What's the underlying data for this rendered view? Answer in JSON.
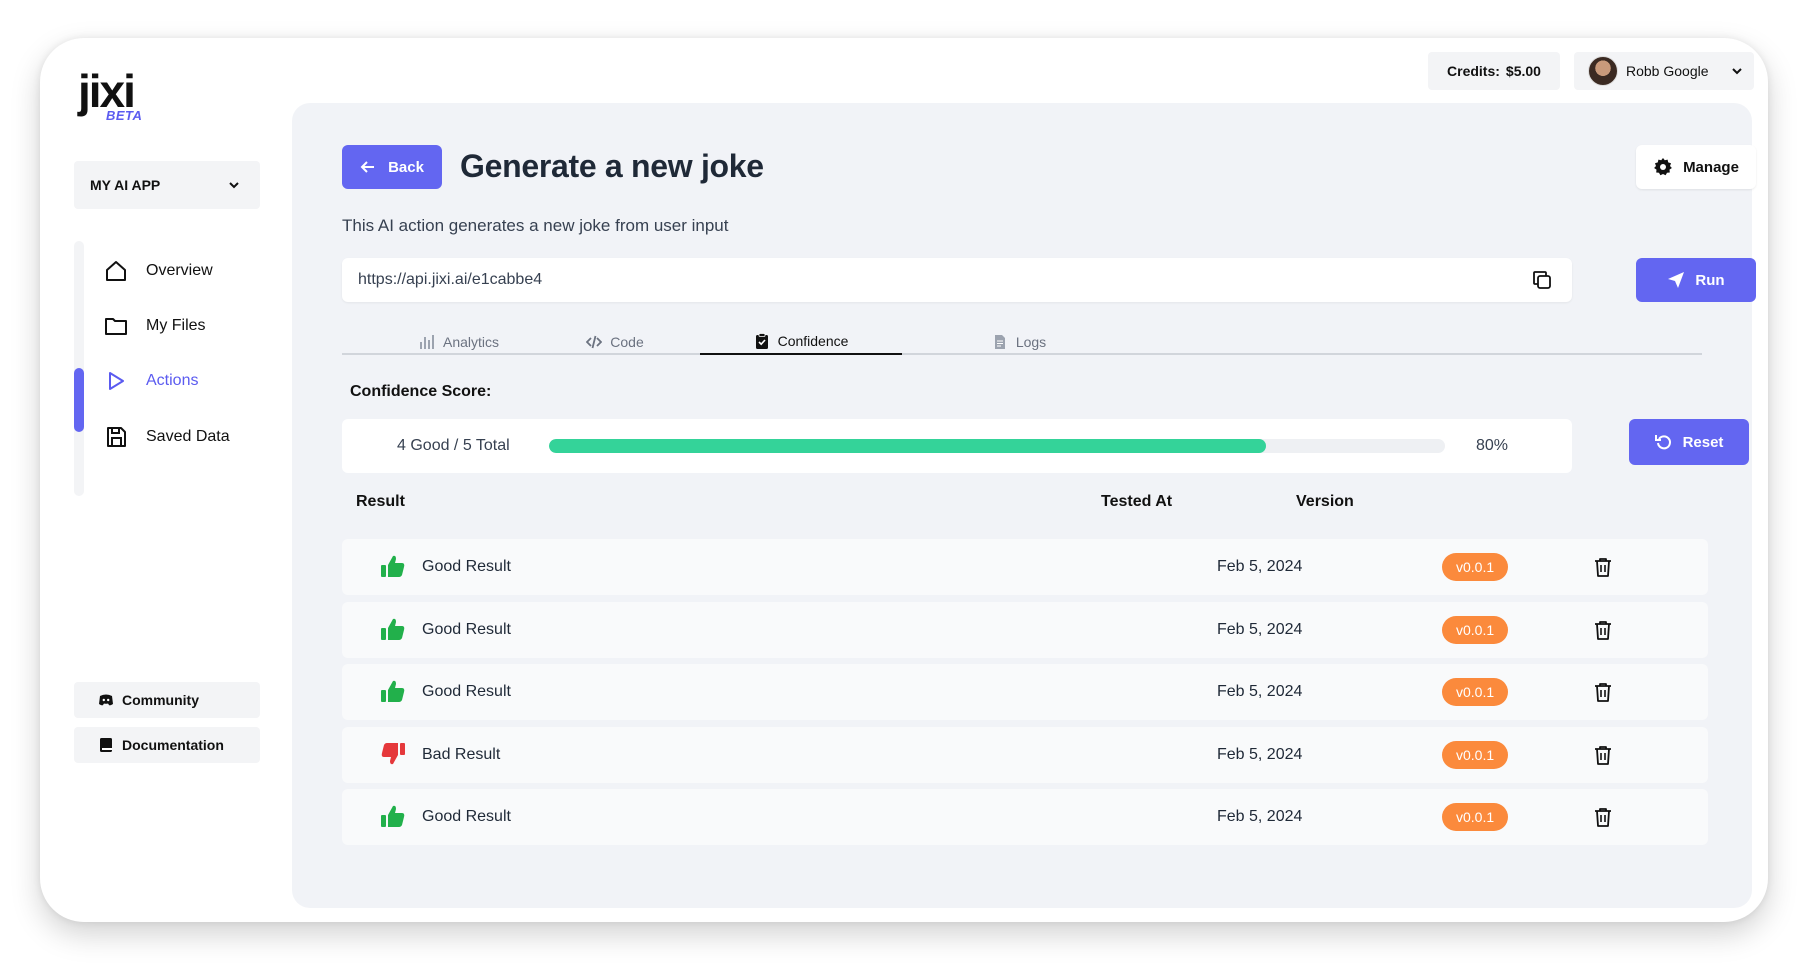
{
  "brand": {
    "name": "jixi",
    "badge": "BETA"
  },
  "app_selector": {
    "label": "MY AI APP"
  },
  "nav": {
    "items": [
      {
        "label": "Overview",
        "icon": "home-icon"
      },
      {
        "label": "My Files",
        "icon": "folder-icon"
      },
      {
        "label": "Actions",
        "icon": "play-icon",
        "active": true
      },
      {
        "label": "Saved Data",
        "icon": "save-icon"
      }
    ]
  },
  "footer_links": {
    "community": "Community",
    "documentation": "Documentation"
  },
  "header": {
    "credits_label": "Credits:",
    "credits_value": "$5.00",
    "user_name": "Robb Google"
  },
  "action": {
    "back_label": "Back",
    "title": "Generate a new joke",
    "manage_label": "Manage",
    "description": "This AI action generates a new joke from user input",
    "url": "https://api.jixi.ai/e1cabbe4",
    "run_label": "Run"
  },
  "tabs": [
    {
      "label": "Analytics",
      "icon": "bar-chart-icon"
    },
    {
      "label": "Code",
      "icon": "code-icon"
    },
    {
      "label": "Confidence",
      "icon": "clipboard-check-icon",
      "active": true
    },
    {
      "label": "Logs",
      "icon": "document-icon"
    }
  ],
  "confidence": {
    "label": "Confidence Score:",
    "summary": "4 Good / 5 Total",
    "percent_text": "80%",
    "progress": 0.8,
    "reset_label": "Reset"
  },
  "table": {
    "headers": {
      "result": "Result",
      "tested_at": "Tested At",
      "version": "Version"
    },
    "rows": [
      {
        "result": "Good Result",
        "good": true,
        "tested_at": "Feb 5, 2024",
        "version": "v0.0.1"
      },
      {
        "result": "Good Result",
        "good": true,
        "tested_at": "Feb 5, 2024",
        "version": "v0.0.1"
      },
      {
        "result": "Good Result",
        "good": true,
        "tested_at": "Feb 5, 2024",
        "version": "v0.0.1"
      },
      {
        "result": "Bad Result",
        "good": false,
        "tested_at": "Feb 5, 2024",
        "version": "v0.0.1"
      },
      {
        "result": "Good Result",
        "good": true,
        "tested_at": "Feb 5, 2024",
        "version": "v0.0.1"
      }
    ]
  },
  "colors": {
    "accent": "#6366f1",
    "progress": "#34d399",
    "version_badge": "#fb8a3c",
    "good": "#22b04b",
    "bad": "#e5383b"
  }
}
